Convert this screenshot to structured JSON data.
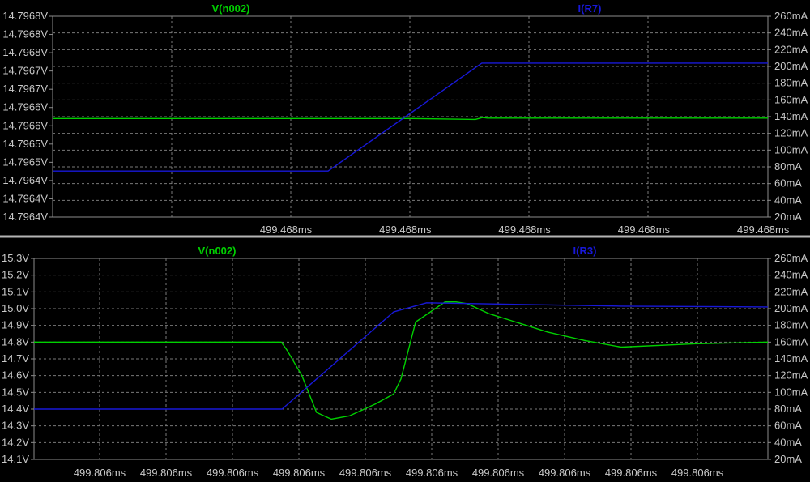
{
  "colors": {
    "background": "#000000",
    "grid": "#7a7a7a",
    "frame": "#8c8c8c",
    "tick_text": "#c8c8c8",
    "separator": "#b4b4b4",
    "voltage_trace": "#00d000",
    "current_trace": "#1818d8"
  },
  "chart_data": [
    {
      "type": "line",
      "voltage_label": "V(n002)",
      "current_label": "I(R7)",
      "x_tick_labels": [
        "499.468ms",
        "499.468ms",
        "499.468ms",
        "499.468ms",
        "499.468ms",
        "499.468ms"
      ],
      "left_axis": {
        "ticks": [
          "14.7968V",
          "14.7968V",
          "14.7968V",
          "14.7967V",
          "14.7967V",
          "14.7966V",
          "14.7966V",
          "14.7965V",
          "14.7965V",
          "14.7964V",
          "14.7964V",
          "14.7964V"
        ],
        "ylim": [
          0,
          11
        ]
      },
      "right_axis": {
        "ticks": [
          "260mA",
          "240mA",
          "220mA",
          "200mA",
          "180mA",
          "160mA",
          "140mA",
          "120mA",
          "100mA",
          "80mA",
          "60mA",
          "40mA",
          "20mA"
        ],
        "ylim": [
          20,
          260
        ],
        "unit": "mA"
      },
      "grid": true,
      "series": [
        {
          "name": "V(n002)",
          "axis": "left",
          "x": [
            0,
            0.5,
            0.591,
            0.601,
            0.608,
            1
          ],
          "y": [
            5.4,
            5.4,
            5.35,
            5.45,
            5.42,
            5.42
          ]
        },
        {
          "name": "I(R7)",
          "axis": "right",
          "x": [
            0,
            0.385,
            0.6,
            1
          ],
          "y": [
            75,
            75,
            204,
            204
          ]
        }
      ]
    },
    {
      "type": "line",
      "voltage_label": "V(n002)",
      "current_label": "I(R3)",
      "x_tick_labels": [
        "499.806ms",
        "499.806ms",
        "499.806ms",
        "499.806ms",
        "499.806ms",
        "499.806ms",
        "499.806ms",
        "499.806ms",
        "499.806ms",
        "499.806ms"
      ],
      "left_axis": {
        "ticks": [
          "15.3V",
          "15.2V",
          "15.1V",
          "15.0V",
          "14.9V",
          "14.8V",
          "14.7V",
          "14.6V",
          "14.5V",
          "14.4V",
          "14.3V",
          "14.2V",
          "14.1V"
        ],
        "ylim": [
          14.1,
          15.3
        ],
        "unit": "V"
      },
      "right_axis": {
        "ticks": [
          "260mA",
          "240mA",
          "220mA",
          "200mA",
          "180mA",
          "160mA",
          "140mA",
          "120mA",
          "100mA",
          "80mA",
          "60mA",
          "40mA",
          "20mA"
        ],
        "ylim": [
          20,
          260
        ],
        "unit": "mA"
      },
      "grid": true,
      "series": [
        {
          "name": "V(n002)",
          "axis": "left",
          "x": [
            0,
            0.337,
            0.345,
            0.365,
            0.385,
            0.405,
            0.43,
            0.465,
            0.49,
            0.5,
            0.52,
            0.56,
            0.575,
            0.59,
            0.62,
            0.7,
            0.75,
            0.8,
            0.9,
            1
          ],
          "y": [
            14.8,
            14.8,
            14.75,
            14.6,
            14.38,
            14.34,
            14.36,
            14.43,
            14.49,
            14.58,
            14.92,
            15.04,
            15.04,
            15.03,
            14.97,
            14.86,
            14.81,
            14.77,
            14.79,
            14.8
          ]
        },
        {
          "name": "I(R3)",
          "axis": "right",
          "x": [
            0,
            0.338,
            0.49,
            0.535,
            0.6,
            0.8,
            1
          ],
          "y": [
            80,
            80,
            196,
            207,
            206,
            203,
            202
          ]
        }
      ]
    }
  ]
}
